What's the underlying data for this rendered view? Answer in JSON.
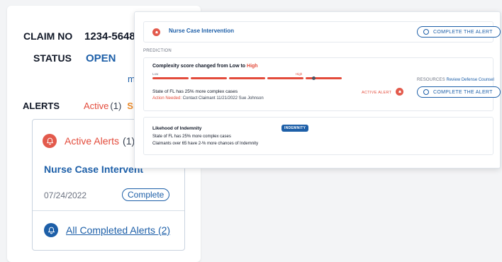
{
  "claim": {
    "claim_no_label": "CLAIM NO",
    "claim_no_value": "1234-5648",
    "status_label": "STATUS",
    "status_value": "OPEN",
    "more_link": "mo"
  },
  "alerts_tabs": {
    "label": "ALERTS",
    "active_label": "Active",
    "active_count": "(1)",
    "second_tab_partial": "Sn"
  },
  "alerts_panel": {
    "active_title": "Active Alerts",
    "active_count": "(1)",
    "item_title": "Nurse Case Intervent",
    "item_date": "07/24/2022",
    "item_action": "Complete",
    "completed_link": "All Completed Alerts (2)"
  },
  "detail_card": {
    "header_title": "Nurse Case Intervention",
    "complete_button": "COMPLETE THE ALERT",
    "prediction_label": "PREDICTION",
    "complexity": {
      "title_prefix": "Complexity score changed from Low to",
      "title_highlight": "High",
      "bar_low": "Low",
      "bar_high": "High",
      "segments": 5,
      "description": "State of FL has 25% more complex cases",
      "action_label": "Action Needed:",
      "action_value": "Contact Claimant 11/21/2022 Sue Johnson",
      "resources_label": "RESOURCES",
      "resources_link": "Review Defense Counsel",
      "active_alert_label": "ACTIVE ALERT",
      "complete_button": "COMPLETE THE ALERT"
    },
    "indemnity": {
      "title": "Likehood of Indemnity",
      "badge": "INDEMNITY",
      "line1": "State of FL has 25% more complex cases",
      "line2": "Claimants over 65 have 2-% more chances of Indemnity"
    }
  },
  "colors": {
    "primary_blue": "#1d5fa8",
    "alert_red": "#e34b3b",
    "snooze_orange": "#e98a2b"
  },
  "icons": [
    "bell-icon",
    "bell-check-icon",
    "check-circle-icon",
    "info-icon"
  ]
}
